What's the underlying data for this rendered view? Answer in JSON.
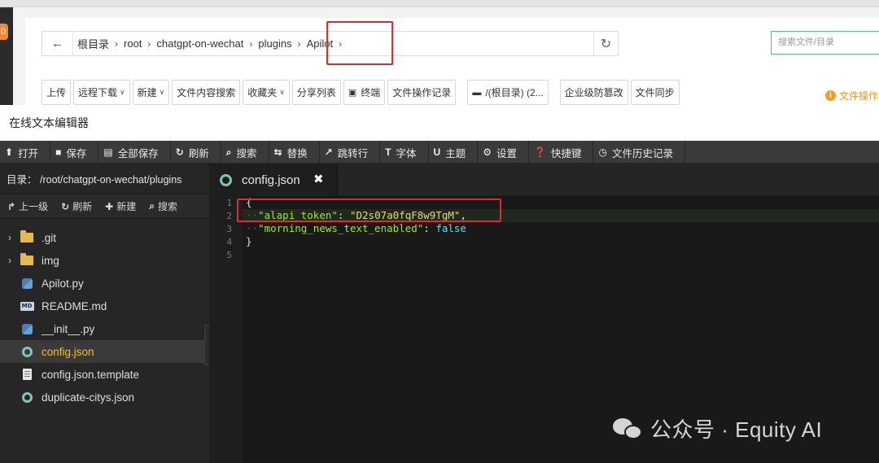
{
  "file_manager": {
    "badge": "0",
    "breadcrumb": [
      {
        "label": "根目录"
      },
      {
        "label": "root"
      },
      {
        "label": "chatgpt-on-wechat"
      },
      {
        "label": "plugins"
      },
      {
        "label": "Apilot"
      }
    ],
    "search_placeholder": "搜索文件/目录",
    "toolbar": {
      "upload": "上传",
      "remote_download": "远程下载",
      "new": "新建",
      "content_search": "文件内容搜索",
      "favorites": "收藏夹",
      "share_list": "分享列表",
      "terminal": "终端",
      "operation_log": "文件操作记录",
      "root_disk": "/(根目录) (2...",
      "tamper_proof": "企业级防篡改",
      "file_sync": "文件同步"
    },
    "file_ops_label": "文件操作"
  },
  "editor": {
    "title": "在线文本编辑器",
    "toolbar": {
      "open": "打开",
      "save": "保存",
      "save_all": "全部保存",
      "refresh": "刷新",
      "search": "搜索",
      "replace": "替换",
      "goto_line": "跳转行",
      "font": "字体",
      "theme": "主题",
      "settings": "设置",
      "shortcuts": "快捷键",
      "history": "文件历史记录"
    },
    "sidebar": {
      "dir_label": "目录：",
      "dir_path": "/root/chatgpt-on-wechat/plugins",
      "actions": {
        "up": "上一级",
        "refresh": "刷新",
        "new": "新建",
        "search": "搜索"
      },
      "files": [
        {
          "name": ".git",
          "icon": "folder-icon",
          "type": "folder"
        },
        {
          "name": "img",
          "icon": "folder-icon",
          "type": "folder"
        },
        {
          "name": "Apilot.py",
          "icon": "python-file-icon",
          "type": "file"
        },
        {
          "name": "README.md",
          "icon": "markdown-file-icon",
          "type": "file"
        },
        {
          "name": "__init__.py",
          "icon": "python-file-icon",
          "type": "file"
        },
        {
          "name": "config.json",
          "icon": "json-file-icon",
          "type": "file",
          "selected": true
        },
        {
          "name": "config.json.template",
          "icon": "text-file-icon",
          "type": "file"
        },
        {
          "name": "duplicate-citys.json",
          "icon": "json-file-icon",
          "type": "file"
        }
      ]
    },
    "tab": {
      "label": "config.json"
    },
    "code": {
      "line_numbers": [
        "1",
        "2",
        "3",
        "4",
        "5"
      ],
      "l1": "{",
      "l2_key": "\"alapi_token\"",
      "l2_colon": ": ",
      "l2_val": "\"D2s07a0fqF8w9TgM\"",
      "l2_comma": ",",
      "l3_key": "\"morning_news_text_enabled\"",
      "l3_colon": ": ",
      "l3_val": "false",
      "l4": "}"
    }
  },
  "watermark": {
    "text": "公众号 · Equity AI"
  },
  "colors": {
    "highlight": "#e02b2b",
    "selected_file": "#f0c030",
    "json_key": "#a6e22e",
    "json_string": "#e6db74",
    "json_bool": "#66d9ef"
  }
}
